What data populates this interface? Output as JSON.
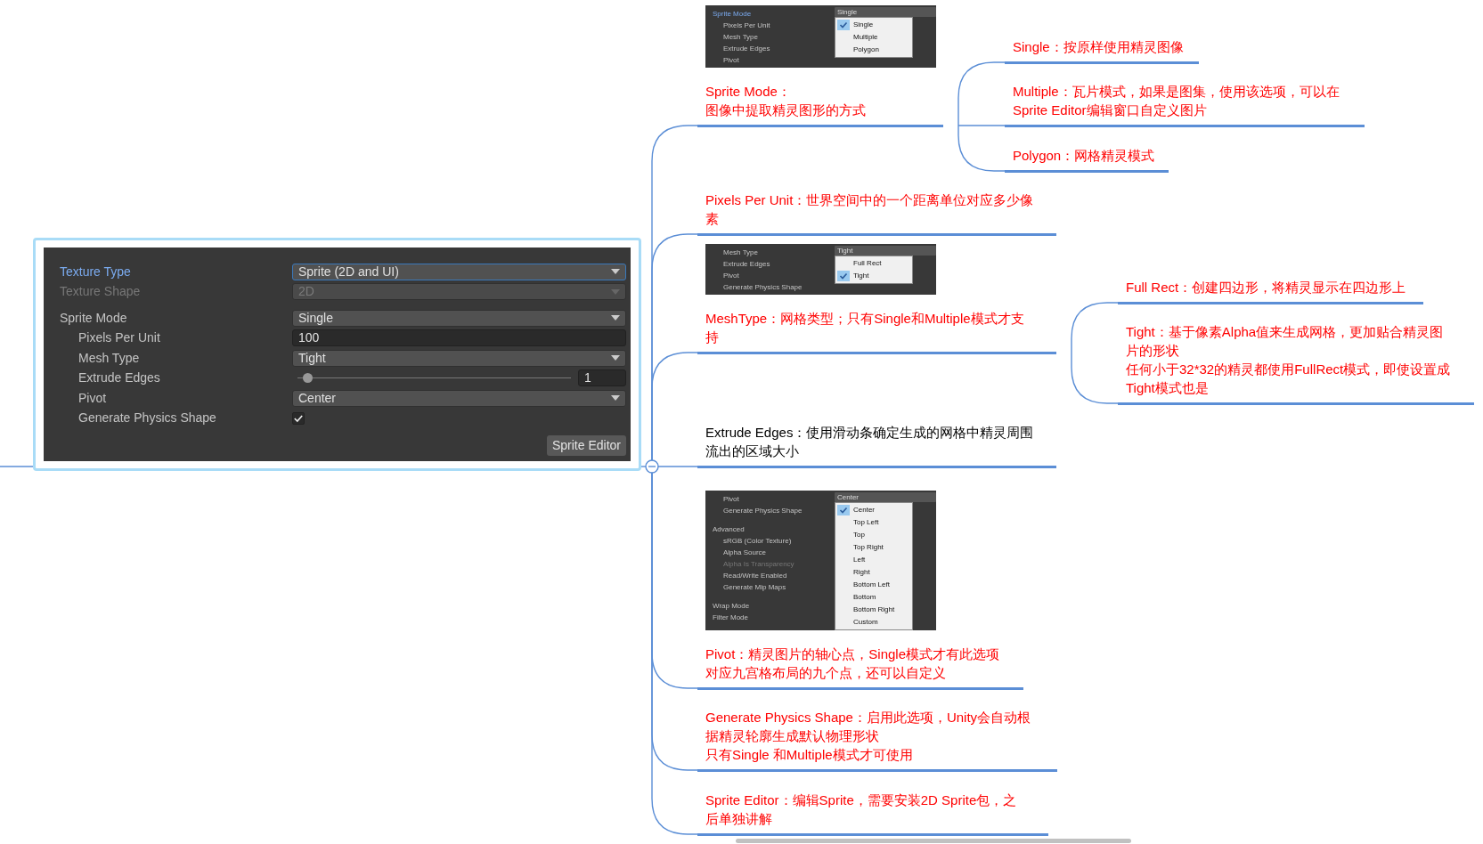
{
  "inspector_panel": {
    "rows": [
      {
        "label": "Texture Type",
        "kind": "dropdown",
        "value": "Sprite (2D and UI)",
        "focused": true,
        "disabled": false
      },
      {
        "label": "Texture Shape",
        "kind": "dropdown",
        "value": "2D",
        "focused": false,
        "disabled": true
      },
      {
        "label": "Sprite Mode",
        "kind": "dropdown",
        "value": "Single",
        "focused": false,
        "disabled": false,
        "children": [
          {
            "label": "Pixels Per Unit",
            "kind": "number",
            "value": "100",
            "focused": false,
            "disabled": false
          },
          {
            "label": "Mesh Type",
            "kind": "dropdown",
            "value": "Tight",
            "focused": false,
            "disabled": false
          },
          {
            "label": "Extrude Edges",
            "kind": "slider",
            "level": 0.02,
            "value": "1",
            "focused": false,
            "disabled": false
          },
          {
            "label": "Pivot",
            "kind": "dropdown",
            "value": "Center",
            "focused": false,
            "disabled": false
          },
          {
            "label": "Generate Physics Shape",
            "kind": "checkbox",
            "checked": true,
            "focused": false,
            "disabled": false
          }
        ]
      }
    ],
    "button": "Sprite Editor"
  },
  "branches": [
    {
      "text": [
        "Sprite Mode：",
        "图像中提取精灵图形的方式"
      ],
      "color": "#ff0000",
      "inset": {
        "labels": [
          {
            "text": "Sprite Mode",
            "kind": "focused"
          },
          {
            "text": "Pixels Per Unit",
            "kind": "indented"
          },
          {
            "text": "Mesh Type",
            "kind": "indented"
          },
          {
            "text": "Extrude Edges",
            "kind": "indented"
          },
          {
            "text": "Pivot",
            "kind": "indented"
          }
        ],
        "dropdown": "Single",
        "options": [
          {
            "label": "Single",
            "checked": true
          },
          {
            "label": "Multiple",
            "checked": false
          },
          {
            "label": "Polygon",
            "checked": false
          }
        ]
      },
      "children": [
        {
          "text": [
            "Single：按原样使用精灵图像"
          ],
          "color": "#ff0000"
        },
        {
          "text": [
            "Multiple：瓦片模式，如果是图集，使用该选项，可以在",
            "Sprite Editor编辑窗口自定义图片"
          ],
          "color": "#ff0000"
        },
        {
          "text": [
            "Polygon：网格精灵模式"
          ],
          "color": "#ff0000"
        }
      ]
    },
    {
      "text": [
        "Pixels Per Unit：世界空间中的一个距离单位对应多少像",
        "素"
      ],
      "color": "#ff0000"
    },
    {
      "text": [
        "MeshType：网格类型；只有Single和Multiple模式才支",
        "持"
      ],
      "color": "#ff0000",
      "inset": {
        "labels": [
          {
            "text": "Mesh Type",
            "kind": "indented"
          },
          {
            "text": "Extrude Edges",
            "kind": "indented"
          },
          {
            "text": "Pivot",
            "kind": "indented"
          },
          {
            "text": "Generate Physics Shape",
            "kind": "indented"
          }
        ],
        "dropdown": "Tight",
        "options": [
          {
            "label": "Full Rect",
            "checked": false
          },
          {
            "label": "Tight",
            "checked": true
          }
        ]
      },
      "children": [
        {
          "text": [
            "Full Rect：创建四边形，将精灵显示在四边形上"
          ],
          "color": "#ff0000"
        },
        {
          "text": [
            "Tight：基于像素Alpha值来生成网格，更加贴合精灵图",
            "片的形状",
            "任何小于32*32的精灵都使用FullRect模式，即使设置成",
            "Tight模式也是"
          ],
          "color": "#ff0000"
        }
      ]
    },
    {
      "text": [
        "Extrude Edges：使用滑动条确定生成的网格中精灵周围",
        "流出的区域大小"
      ],
      "color": "#000000"
    },
    {
      "text": [
        "Pivot：精灵图片的轴心点，Single模式才有此选项",
        "对应九宫格布局的九个点，还可以自定义"
      ],
      "color": "#ff0000",
      "inset": {
        "labels": [
          {
            "text": "Pivot",
            "kind": "indented"
          },
          {
            "text": "Generate Physics Shape",
            "kind": "indented"
          },
          {
            "text": "Advanced",
            "kind": "section"
          },
          {
            "text": "sRGB (Color Texture)",
            "kind": "indented"
          },
          {
            "text": "Alpha Source",
            "kind": "indented"
          },
          {
            "text": "Alpha Is Transparency",
            "kind": "dim"
          },
          {
            "text": "Read/Write Enabled",
            "kind": "indented"
          },
          {
            "text": "Generate Mip Maps",
            "kind": "indented"
          },
          {
            "text": "Wrap Mode",
            "kind": "section"
          },
          {
            "text": "Filter Mode",
            "kind": "plain"
          }
        ],
        "dropdown": "Center",
        "options": [
          {
            "label": "Center",
            "checked": true
          },
          {
            "label": "Top Left",
            "checked": false
          },
          {
            "label": "Top",
            "checked": false
          },
          {
            "label": "Top Right",
            "checked": false
          },
          {
            "label": "Left",
            "checked": false
          },
          {
            "label": "Right",
            "checked": false
          },
          {
            "label": "Bottom Left",
            "checked": false
          },
          {
            "label": "Bottom",
            "checked": false
          },
          {
            "label": "Bottom Right",
            "checked": false
          },
          {
            "label": "Custom",
            "checked": false
          }
        ]
      }
    },
    {
      "text": [
        "Generate Physics Shape：启用此选项，Unity会自动根",
        "据精灵轮廓生成默认物理形状",
        "只有Single 和Multiple模式才可使用"
      ],
      "color": "#ff0000"
    },
    {
      "text": [
        "Sprite Editor：编辑Sprite，需要安装2D Sprite包，之",
        "后单独讲解"
      ],
      "color": "#ff0000"
    }
  ]
}
